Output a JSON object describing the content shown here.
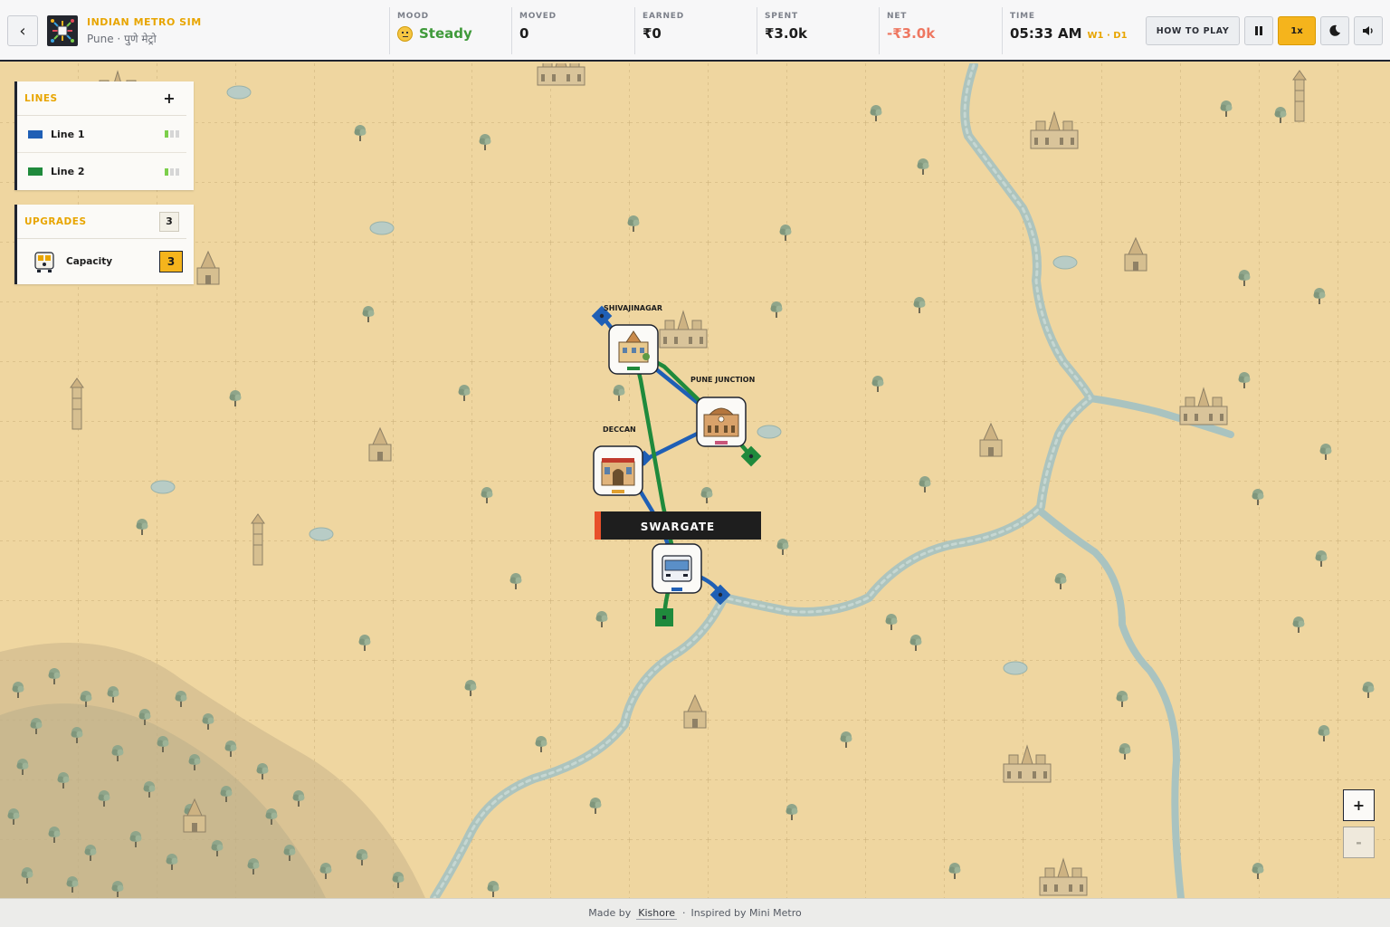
{
  "app": {
    "title": "INDIAN METRO SIM",
    "city": "Pune · पुणे मेट्रो",
    "back_icon": "chevron-left-icon",
    "logo_icon": "metro-network-logo"
  },
  "hud": {
    "mood": {
      "label": "MOOD",
      "value": "Steady",
      "icon": "neutral-face-icon"
    },
    "moved": {
      "label": "MOVED",
      "value": "0"
    },
    "earned": {
      "label": "EARNED",
      "value": "₹0"
    },
    "spent": {
      "label": "SPENT",
      "value": "₹3.0k"
    },
    "net": {
      "label": "NET",
      "value": "-₹3.0k"
    },
    "time": {
      "label": "TIME",
      "value": "05:33 AM",
      "day": "W1 · D1"
    }
  },
  "controls": {
    "how_to_play": "HOW TO PLAY",
    "pause_icon": "pause-icon",
    "speed": "1x",
    "theme_icon": "moon-icon",
    "sound_icon": "speaker-icon"
  },
  "lines_panel": {
    "title": "LINES",
    "add_label": "+",
    "items": [
      {
        "name": "Line 1",
        "color": "#1f5fb5",
        "capacity_used": 1,
        "capacity_total": 3
      },
      {
        "name": "Line 2",
        "color": "#1f8a3c",
        "capacity_used": 1,
        "capacity_total": 3
      }
    ]
  },
  "upgrades_panel": {
    "title": "UPGRADES",
    "count": "3",
    "items": [
      {
        "name": "Capacity",
        "cost": "3",
        "icon": "train-car-icon"
      }
    ]
  },
  "map": {
    "stations": [
      {
        "id": "shivajinagar",
        "name": "SHIVAJINAGAR",
        "icon": "building-station-icon"
      },
      {
        "id": "pune-junction",
        "name": "PUNE JUNCTION",
        "icon": "railway-station-icon"
      },
      {
        "id": "deccan",
        "name": "DECCAN",
        "icon": "market-station-icon"
      },
      {
        "id": "swargate",
        "name": "SWARGATE",
        "icon": "bus-station-icon"
      }
    ],
    "selected_station": "SWARGATE",
    "colors": {
      "line1": "#1f5fb5",
      "line2": "#1f8a3c",
      "sand": "#efd6a0",
      "river": "#a9c3c0"
    }
  },
  "zoom": {
    "in": "+",
    "out": "-"
  },
  "footer": {
    "made_by": "Made by",
    "author": "Kishore",
    "separator": "·",
    "inspired": "Inspired by Mini Metro"
  }
}
